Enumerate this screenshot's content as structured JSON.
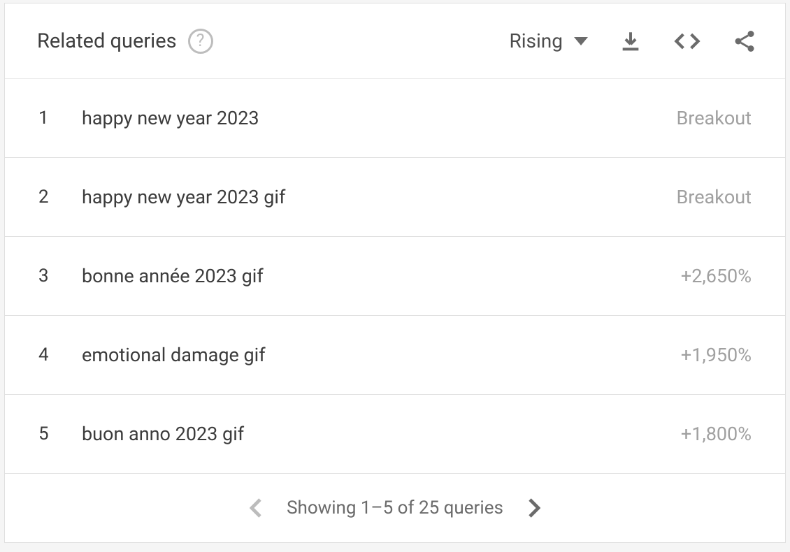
{
  "header": {
    "title": "Related queries",
    "sort_label": "Rising"
  },
  "queries": [
    {
      "rank": "1",
      "label": "happy new year 2023",
      "value": "Breakout"
    },
    {
      "rank": "2",
      "label": "happy new year 2023 gif",
      "value": "Breakout"
    },
    {
      "rank": "3",
      "label": "bonne année 2023 gif",
      "value": "+2,650%"
    },
    {
      "rank": "4",
      "label": "emotional damage gif",
      "value": "+1,950%"
    },
    {
      "rank": "5",
      "label": "buon anno 2023 gif",
      "value": "+1,800%"
    }
  ],
  "footer": {
    "pagination_text": "Showing 1–5 of 25 queries"
  }
}
